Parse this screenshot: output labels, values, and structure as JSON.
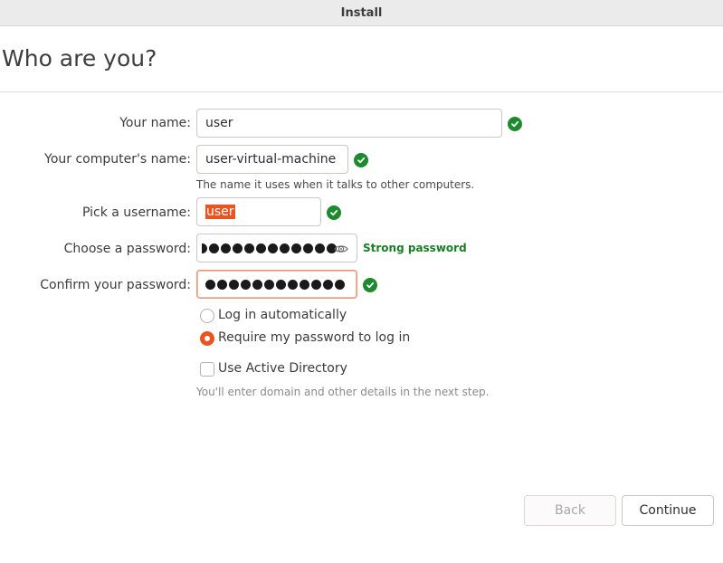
{
  "window": {
    "title": "Install"
  },
  "page": {
    "title": "Who are you?"
  },
  "form": {
    "name": {
      "label": "Your name:",
      "value": "user"
    },
    "computer": {
      "label": "Your computer's name:",
      "value": "user-virtual-machine",
      "hint": "The name it uses when it talks to other computers."
    },
    "username": {
      "label": "Pick a username:",
      "value": "user"
    },
    "password": {
      "label": "Choose a password:",
      "strength": "Strong password",
      "masked_count": 12
    },
    "confirm": {
      "label": "Confirm your password:",
      "masked_count": 12
    }
  },
  "login_options": {
    "auto": {
      "label": "Log in automatically",
      "checked": false
    },
    "require_password": {
      "label": "Require my password to log in",
      "checked": true
    }
  },
  "active_directory": {
    "label": "Use Active Directory",
    "checked": false,
    "hint": "You'll enter domain and other details in the next step."
  },
  "buttons": {
    "back": "Back",
    "continue": "Continue"
  },
  "colors": {
    "accent": "#e95420",
    "success": "#1e8a2e"
  }
}
